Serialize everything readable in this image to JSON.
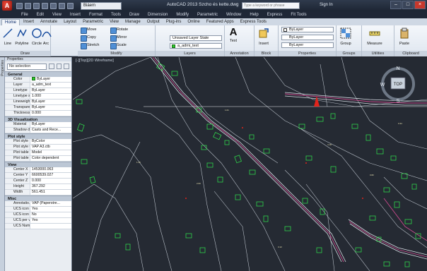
{
  "titlebar": {
    "app_letter": "A",
    "workspace": "Biáem",
    "title": "AutoCAD 2013    Szcho és kette.dwg",
    "search_placeholder": "Type a keyword or phrase",
    "signin": "Sign In"
  },
  "menubar": [
    "File",
    "Edit",
    "View",
    "Insert",
    "Format",
    "Tools",
    "Draw",
    "Dimension",
    "Modify",
    "Parametric",
    "Window",
    "Help",
    "Express",
    "Fit Tools"
  ],
  "ribbon_tabs": [
    "Home",
    "Insert",
    "Annotate",
    "Layout",
    "Parametric",
    "View",
    "Manage",
    "Output",
    "Plug-ins",
    "Online",
    "Featured Apps",
    "Express Tools"
  ],
  "ribbon": {
    "draw": {
      "title": "Draw",
      "line": "Line",
      "polyline": "Polyline",
      "circle": "Circle",
      "arc": "Arc"
    },
    "modify": {
      "title": "Modify",
      "move": "Move",
      "rotate": "Rotate",
      "copy": "Copy",
      "mirror": "Mirror",
      "stretch": "Stretch",
      "scale": "Scale"
    },
    "layers": {
      "title": "Layers",
      "layer_state": "Unsaved Layer State",
      "current_layer": "a_admi_text"
    },
    "annotation": {
      "title": "Annotation",
      "text": "Text"
    },
    "block": {
      "title": "Block",
      "insert": "Insert"
    },
    "properties": {
      "title": "Properties",
      "color": "ByLayer",
      "lineweight": "ByLayer",
      "linetype": "ByLayer"
    },
    "groups": {
      "title": "Groups",
      "group": "Group"
    },
    "utilities": {
      "title": "Utilities",
      "measure": "Measure"
    },
    "clipboard": {
      "title": "Clipboard",
      "paste": "Paste"
    }
  },
  "palette": {
    "title": "Properties",
    "header": "Properties",
    "selection": "No selection",
    "sections": [
      {
        "name": "General",
        "rows": [
          {
            "k": "Color",
            "v": "ByLayer",
            "swatch": true
          },
          {
            "k": "Layer",
            "v": "a_adm_text"
          },
          {
            "k": "Linetype",
            "v": "ByLayer"
          },
          {
            "k": "Linetype sc...",
            "v": "1.000"
          },
          {
            "k": "Lineweight",
            "v": "ByLayer"
          },
          {
            "k": "Transparen...",
            "v": "ByLayer"
          },
          {
            "k": "Thickness",
            "v": "0.000"
          }
        ]
      },
      {
        "name": "3D Visualization",
        "rows": [
          {
            "k": "Material",
            "v": "ByLayer"
          },
          {
            "k": "Shadow di...",
            "v": "Casts and Rece..."
          }
        ]
      },
      {
        "name": "Plot style",
        "rows": [
          {
            "k": "Plot style",
            "v": "ByColor"
          },
          {
            "k": "Plot style t...",
            "v": "VAP A3.ctb"
          },
          {
            "k": "Plot table a...",
            "v": "Model"
          },
          {
            "k": "Plot table t...",
            "v": "Color dependent"
          }
        ]
      },
      {
        "name": "View",
        "rows": [
          {
            "k": "Center X",
            "v": "1453000.063"
          },
          {
            "k": "Center Y",
            "v": "6600539.027"
          },
          {
            "k": "Center Z",
            "v": "0.000"
          },
          {
            "k": "Height",
            "v": "367.292"
          },
          {
            "k": "Width",
            "v": "561.451"
          }
        ]
      },
      {
        "name": "Misc",
        "rows": [
          {
            "k": "Annotatio...",
            "v": "VAP (Paperstre..."
          },
          {
            "k": "UCS icon On",
            "v": "Yes"
          },
          {
            "k": "UCS icon a...",
            "v": "No"
          },
          {
            "k": "UCS per vi...",
            "v": "Yes"
          },
          {
            "k": "UCS Name",
            "v": ""
          }
        ]
      }
    ]
  },
  "canvas": {
    "viewport_label": "[-][Top][2D Wireframe]",
    "viewcube": {
      "n": "N",
      "s": "S",
      "w": "W",
      "top": "TOP"
    }
  }
}
